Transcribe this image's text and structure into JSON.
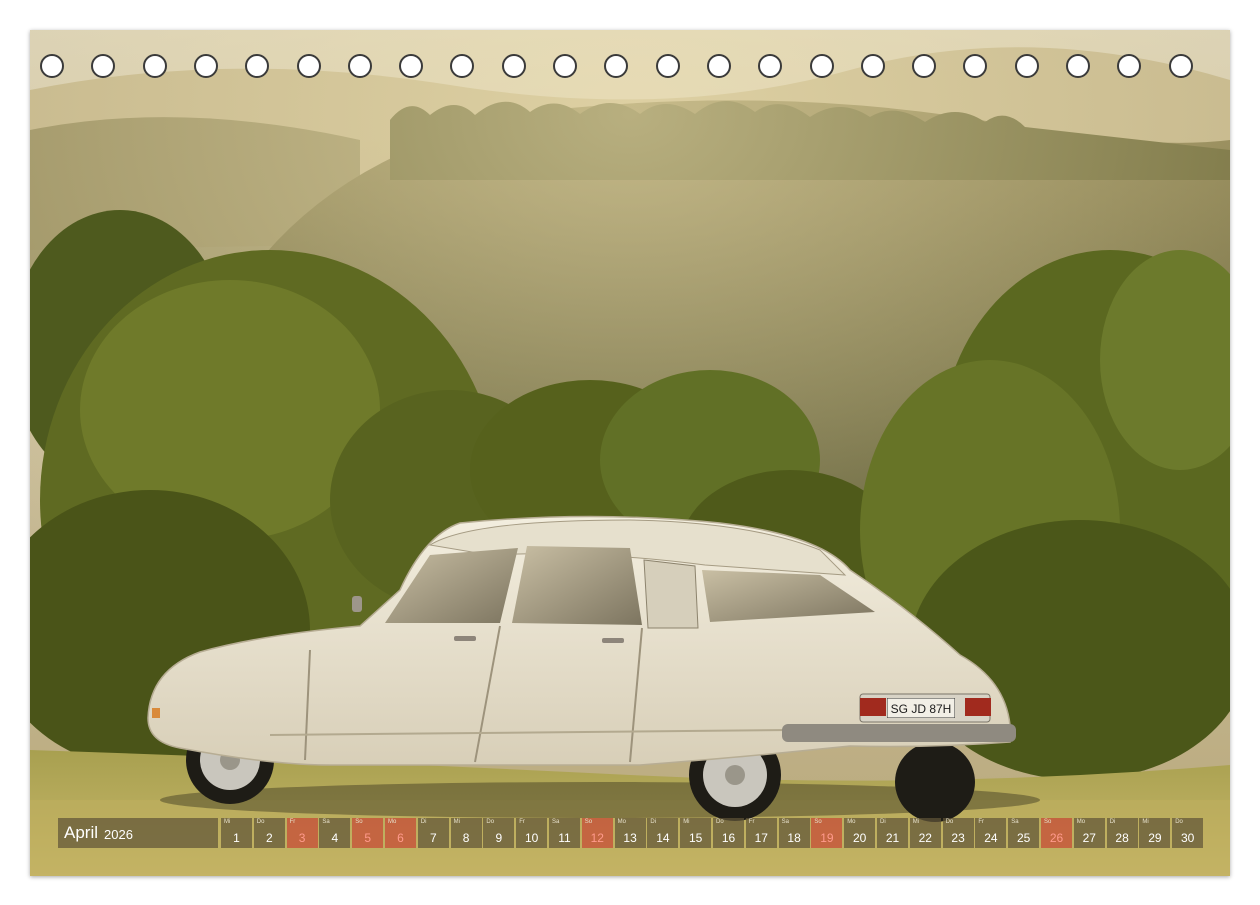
{
  "month": "April",
  "year": "2026",
  "days": [
    {
      "day": "1",
      "weekday": "Mi",
      "weekend": false
    },
    {
      "day": "2",
      "weekday": "Do",
      "weekend": false
    },
    {
      "day": "3",
      "weekday": "Fr",
      "weekend": true
    },
    {
      "day": "4",
      "weekday": "Sa",
      "weekend": false
    },
    {
      "day": "5",
      "weekday": "So",
      "weekend": true
    },
    {
      "day": "6",
      "weekday": "Mo",
      "weekend": true
    },
    {
      "day": "7",
      "weekday": "Di",
      "weekend": false
    },
    {
      "day": "8",
      "weekday": "Mi",
      "weekend": false
    },
    {
      "day": "9",
      "weekday": "Do",
      "weekend": false
    },
    {
      "day": "10",
      "weekday": "Fr",
      "weekend": false
    },
    {
      "day": "11",
      "weekday": "Sa",
      "weekend": false
    },
    {
      "day": "12",
      "weekday": "So",
      "weekend": true
    },
    {
      "day": "13",
      "weekday": "Mo",
      "weekend": false
    },
    {
      "day": "14",
      "weekday": "Di",
      "weekend": false
    },
    {
      "day": "15",
      "weekday": "Mi",
      "weekend": false
    },
    {
      "day": "16",
      "weekday": "Do",
      "weekend": false
    },
    {
      "day": "17",
      "weekday": "Fr",
      "weekend": false
    },
    {
      "day": "18",
      "weekday": "Sa",
      "weekend": false
    },
    {
      "day": "19",
      "weekday": "So",
      "weekend": true
    },
    {
      "day": "20",
      "weekday": "Mo",
      "weekend": false
    },
    {
      "day": "21",
      "weekday": "Di",
      "weekend": false
    },
    {
      "day": "22",
      "weekday": "Mi",
      "weekend": false
    },
    {
      "day": "23",
      "weekday": "Do",
      "weekend": false
    },
    {
      "day": "24",
      "weekday": "Fr",
      "weekend": false
    },
    {
      "day": "25",
      "weekday": "Sa",
      "weekend": false
    },
    {
      "day": "26",
      "weekday": "So",
      "weekend": true
    },
    {
      "day": "27",
      "weekday": "Mo",
      "weekend": false
    },
    {
      "day": "28",
      "weekday": "Di",
      "weekend": false
    },
    {
      "day": "29",
      "weekday": "Mi",
      "weekend": false
    },
    {
      "day": "30",
      "weekday": "Do",
      "weekend": false
    }
  ],
  "license_plate": "SG JD 87H",
  "colors": {
    "weekend_accent": "#c82828",
    "strip_background": "#5f5537",
    "car_body": "#ece6d4"
  }
}
